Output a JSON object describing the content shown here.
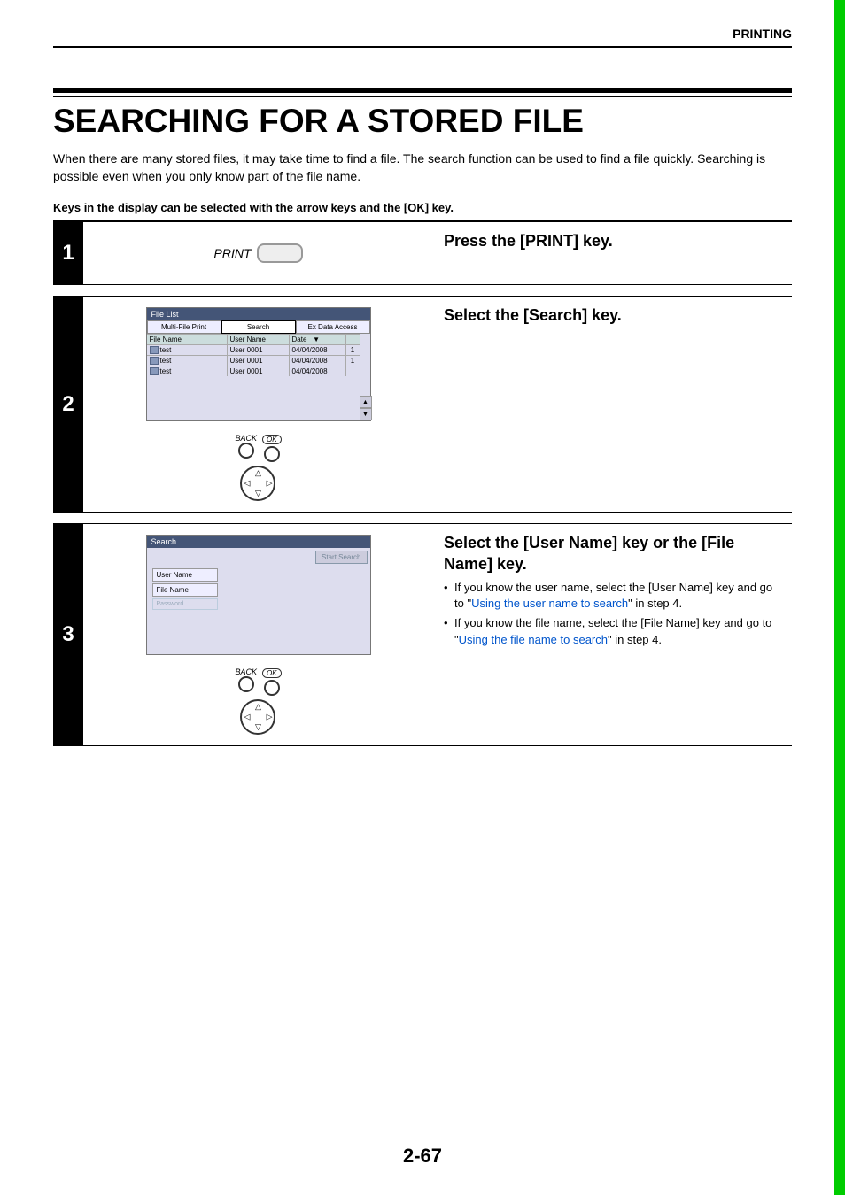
{
  "header": {
    "section": "PRINTING"
  },
  "title": "SEARCHING FOR A STORED FILE",
  "intro": "When there are many stored files, it may take time to find a file. The search function can be used to find a file quickly. Searching is possible even when you only know part of the file name.",
  "note": "Keys in the display can be selected with the arrow keys and the [OK] key.",
  "steps": {
    "s1": {
      "num": "1",
      "heading": "Press the [PRINT] key.",
      "print_label": "PRINT"
    },
    "s2": {
      "num": "2",
      "heading": "Select the [Search] key.",
      "screen": {
        "title": "File List",
        "tab1": "Multi-File Print",
        "tab2": "Search",
        "tab3": "Ex Data Access",
        "col_file": "File Name",
        "col_user": "User Name",
        "col_date": "Date",
        "date_sort": "▼",
        "rows": [
          {
            "file": "test",
            "user": "User 0001",
            "date": "04/04/2008",
            "count": "1"
          },
          {
            "file": "test",
            "user": "User 0001",
            "date": "04/04/2008",
            "count": "1"
          },
          {
            "file": "test",
            "user": "User 0001",
            "date": "04/04/2008",
            "count": ""
          }
        ]
      },
      "nav": {
        "back": "BACK",
        "ok": "OK"
      }
    },
    "s3": {
      "num": "3",
      "heading": "Select the [User Name] key or the [File Name] key.",
      "bullet1a": "If you know the user name, select the [User Name] key and go to \"",
      "bullet1_link": "Using the user name to search",
      "bullet1b": "\" in step 4.",
      "bullet2a": "If you know the file name, select the [File Name] key and go to \"",
      "bullet2_link": "Using the file name to search",
      "bullet2b": "\" in step 4.",
      "screen": {
        "title": "Search",
        "start": "Start Search",
        "opt_user": "User Name",
        "opt_file": "File Name",
        "opt_pw": "Password"
      },
      "nav": {
        "back": "BACK",
        "ok": "OK"
      }
    }
  },
  "page": "2-67"
}
